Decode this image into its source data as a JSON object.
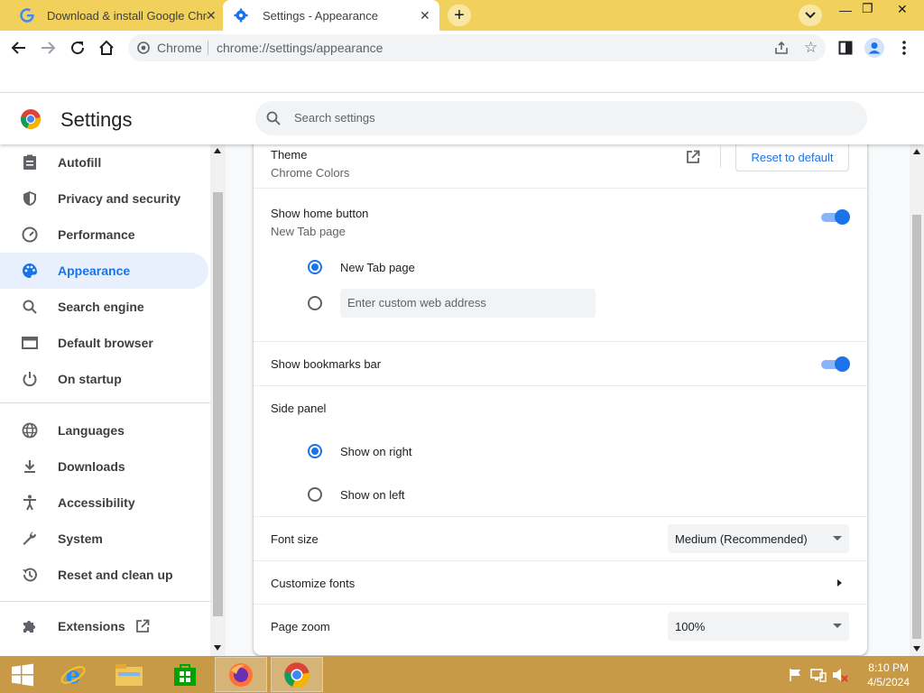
{
  "tabs": [
    {
      "title": "Download & install Google Chrome",
      "active": false
    },
    {
      "title": "Settings - Appearance",
      "active": true
    }
  ],
  "toolbar": {
    "omnibox_chip": "Chrome",
    "url": "chrome://settings/appearance"
  },
  "settings": {
    "title": "Settings",
    "search_placeholder": "Search settings"
  },
  "sidebar": {
    "items": [
      {
        "label": "Autofill",
        "icon": "autofill-icon"
      },
      {
        "label": "Privacy and security",
        "icon": "shield-icon"
      },
      {
        "label": "Performance",
        "icon": "speedometer-icon"
      },
      {
        "label": "Appearance",
        "icon": "palette-icon",
        "active": true
      },
      {
        "label": "Search engine",
        "icon": "search-icon"
      },
      {
        "label": "Default browser",
        "icon": "browser-window-icon"
      },
      {
        "label": "On startup",
        "icon": "power-icon"
      },
      {
        "label": "Languages",
        "icon": "globe-icon"
      },
      {
        "label": "Downloads",
        "icon": "download-icon"
      },
      {
        "label": "Accessibility",
        "icon": "accessibility-icon"
      },
      {
        "label": "System",
        "icon": "wrench-icon"
      },
      {
        "label": "Reset and clean up",
        "icon": "history-icon"
      },
      {
        "label": "Extensions",
        "icon": "puzzle-icon"
      }
    ]
  },
  "appearance": {
    "theme": {
      "label": "Theme",
      "value": "Chrome Colors",
      "reset_label": "Reset to default"
    },
    "home_button": {
      "label": "Show home button",
      "value": "New Tab page",
      "enabled": true,
      "options": [
        "New Tab page",
        ""
      ],
      "custom_placeholder": "Enter custom web address"
    },
    "bookmarks_bar": {
      "label": "Show bookmarks bar",
      "enabled": true
    },
    "side_panel": {
      "label": "Side panel",
      "options": [
        "Show on right",
        "Show on left"
      ],
      "selected": "Show on right"
    },
    "font_size": {
      "label": "Font size",
      "value": "Medium (Recommended)"
    },
    "customize_fonts": {
      "label": "Customize fonts"
    },
    "page_zoom": {
      "label": "Page zoom",
      "value": "100%"
    }
  },
  "taskbar": {
    "time": "8:10 PM",
    "date": "4/5/2024"
  },
  "colors": {
    "accent": "#1a73e8",
    "tabstrip": "#f1d15c",
    "taskbar": "#c89a48",
    "active_nav_bg": "#e8f0fe"
  }
}
